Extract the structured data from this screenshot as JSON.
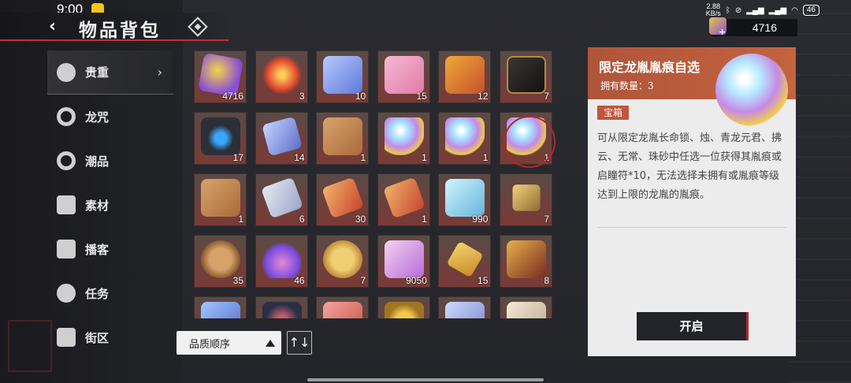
{
  "status_bar": {
    "time": "9:00",
    "net_speed_value": "2.88",
    "net_speed_unit": "KB/s",
    "battery": "46"
  },
  "header": {
    "title": "物品背包",
    "back_icon": "chevron-left-icon",
    "diamond_icon": "diamond-icon"
  },
  "currency": {
    "value": "4716",
    "icon": "gem-plus-icon"
  },
  "sidebar": {
    "items": [
      {
        "label": "贵重",
        "icon": "star-badge-icon",
        "active": true
      },
      {
        "label": "龙咒",
        "icon": "ring-icon",
        "active": false
      },
      {
        "label": "潮品",
        "icon": "hanger-icon",
        "active": false
      },
      {
        "label": "素材",
        "icon": "cube-icon",
        "active": false
      },
      {
        "label": "播客",
        "icon": "podcast-icon",
        "active": false
      },
      {
        "label": "任务",
        "icon": "film-reel-icon",
        "active": false
      },
      {
        "label": "街区",
        "icon": "street-icon",
        "active": false
      }
    ]
  },
  "grid": {
    "items": [
      {
        "art": "gem",
        "count": "4716"
      },
      {
        "art": "fire",
        "count": "3"
      },
      {
        "art": "cube",
        "count": "10"
      },
      {
        "art": "gift",
        "count": "15"
      },
      {
        "art": "crate",
        "count": "12"
      },
      {
        "art": "book",
        "count": "7"
      },
      {
        "art": "box",
        "count": "17"
      },
      {
        "art": "crystal",
        "count": "14"
      },
      {
        "art": "card",
        "count": "1"
      },
      {
        "art": "orb",
        "count": "1"
      },
      {
        "art": "orb",
        "count": "1"
      },
      {
        "art": "orb",
        "count": "1",
        "selected": true
      },
      {
        "art": "card",
        "count": "1"
      },
      {
        "art": "ticket",
        "count": "6"
      },
      {
        "art": "ticket-red",
        "count": "30"
      },
      {
        "art": "ticket-red",
        "count": "1"
      },
      {
        "art": "ice",
        "count": "990"
      },
      {
        "art": "scissors",
        "count": "7"
      },
      {
        "art": "palette",
        "count": "35"
      },
      {
        "art": "potion",
        "count": "46"
      },
      {
        "art": "palette2",
        "count": "7"
      },
      {
        "art": "sand",
        "count": "9050"
      },
      {
        "art": "feather",
        "count": "15"
      },
      {
        "art": "scroll",
        "count": "8"
      },
      {
        "art": "blue",
        "count": ""
      },
      {
        "art": "dark",
        "count": ""
      },
      {
        "art": "pink",
        "count": ""
      },
      {
        "art": "coins",
        "count": ""
      },
      {
        "art": "pyramid",
        "count": ""
      },
      {
        "art": "paper",
        "count": ""
      }
    ]
  },
  "sort": {
    "label": "品质顺序",
    "toggle_label": "↑↓"
  },
  "detail": {
    "name": "限定龙胤胤痕自选",
    "owned": "拥有数量：3",
    "tag": "宝箱",
    "description": "可从限定龙胤长命锁、烛、青龙元君、拂云、无常、珠砂中任选一位获得其胤痕或启瞳符*10，无法选择未拥有或胤痕等级达到上限的龙胤的胤痕。",
    "button": "开启"
  }
}
